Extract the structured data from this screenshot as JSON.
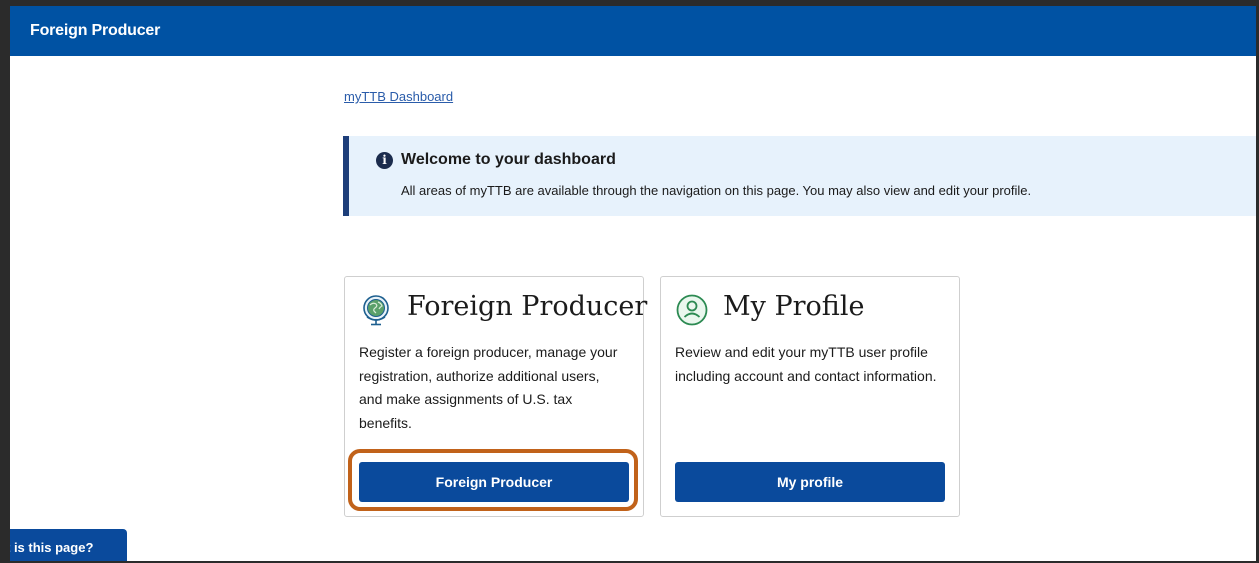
{
  "header": {
    "title": "Foreign Producer"
  },
  "breadcrumb": {
    "link": "myTTB Dashboard"
  },
  "alert": {
    "heading": "Welcome to your dashboard",
    "body": "All areas of myTTB are available through the navigation on this page. You may also view and edit your profile.",
    "icon": "info-icon"
  },
  "cards": [
    {
      "title": "Foreign Producer",
      "icon": "globe-icon",
      "text": "Register a foreign producer, manage your registration, authorize additional users, and make assignments of U.S. tax benefits.",
      "button": "Foreign Producer"
    },
    {
      "title": "My Profile",
      "icon": "user-profile-icon",
      "text": "Review and edit your myTTB user profile including account and contact information.",
      "button": "My profile"
    }
  ],
  "help_tab": {
    "label": "t is this page?"
  },
  "colors": {
    "header": "#0052a3",
    "button": "#0a4a9c",
    "alert_bg": "#e7f2fc",
    "highlight": "#c1621a"
  }
}
